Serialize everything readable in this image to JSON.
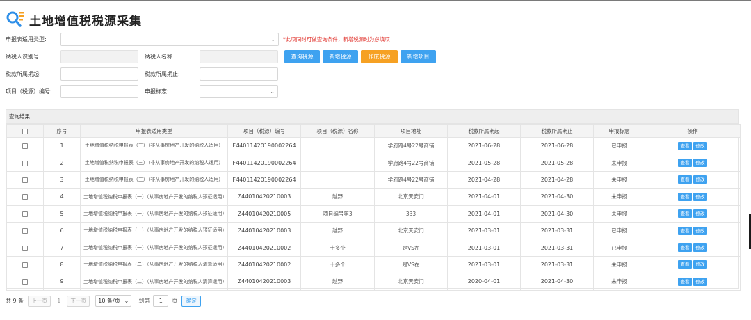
{
  "page": {
    "title": "土地增值税税源采集"
  },
  "form": {
    "report_type": {
      "label": "申报表适用类型:",
      "value": ""
    },
    "hint": "*此项同时可做查询条件，新增税源时为必填项",
    "taxpayer_id": {
      "label": "纳税人识别号:",
      "value": ""
    },
    "taxpayer_name": {
      "label": "纳税人名称:",
      "value": ""
    },
    "period_start": {
      "label": "税款所属期起:",
      "value": ""
    },
    "period_end": {
      "label": "税款所属期止:",
      "value": ""
    },
    "project_code": {
      "label": "项目（税源）编号:",
      "value": ""
    },
    "report_flag": {
      "label": "申报标志:",
      "value": ""
    }
  },
  "actions": {
    "query": "查询税源",
    "add_source": "新增税源",
    "void_source": "作废税源",
    "add_project": "新增项目"
  },
  "colors": {
    "primary": "#3ea2f0",
    "warning": "#f6a123",
    "hint": "#e0302a"
  },
  "results": {
    "heading": "查询结果",
    "columns": [
      "序号",
      "申报表适用类型",
      "项目（税源）编号",
      "项目（税源）名称",
      "项目地址",
      "税款所属期起",
      "税款所属期止",
      "申报标志",
      "操作"
    ],
    "view_label": "查看",
    "edit_label": "修改",
    "rows": [
      {
        "no": "1",
        "type": "土地增值税纳税申报表（三）（非从事房地产开发的纳税人适用）",
        "code": "F44011420190002264",
        "name": "",
        "address": "学府路4号22号商铺",
        "start": "2021-06-28",
        "end": "2021-06-28",
        "flag": "已申报"
      },
      {
        "no": "2",
        "type": "土地增值税纳税申报表（三）（非从事房地产开发的纳税人适用）",
        "code": "F44011420190002264",
        "name": "",
        "address": "学府路4号22号商铺",
        "start": "2021-05-28",
        "end": "2021-05-28",
        "flag": "未申报"
      },
      {
        "no": "3",
        "type": "土地增值税纳税申报表（三）（非从事房地产开发的纳税人适用）",
        "code": "F44011420190002264",
        "name": "",
        "address": "学府路4号22号商铺",
        "start": "2021-04-28",
        "end": "2021-04-28",
        "flag": "未申报"
      },
      {
        "no": "4",
        "type": "土地增值税纳税申报表（一）（从事房地产开发的纳税人预征适用）",
        "code": "Z44010420210003",
        "name": "越野",
        "address": "北京天安门",
        "start": "2021-04-01",
        "end": "2021-04-30",
        "flag": "未申报"
      },
      {
        "no": "5",
        "type": "土地增值税纳税申报表（一）（从事房地产开发的纳税人预征适用）",
        "code": "Z44010420210005",
        "name": "项目编号第3",
        "address": "333",
        "start": "2021-04-01",
        "end": "2021-04-30",
        "flag": "未申报"
      },
      {
        "no": "6",
        "type": "土地增值税纳税申报表（一）（从事房地产开发的纳税人预征适用）",
        "code": "Z44010420210003",
        "name": "越野",
        "address": "北京天安门",
        "start": "2021-03-01",
        "end": "2021-03-31",
        "flag": "已申报"
      },
      {
        "no": "7",
        "type": "土地增值税纳税申报表（一）（从事房地产开发的纳税人预征适用）",
        "code": "Z44010420210002",
        "name": "十多个",
        "address": "是VS在",
        "start": "2021-03-01",
        "end": "2021-03-31",
        "flag": "已申报"
      },
      {
        "no": "8",
        "type": "土地增值税纳税申报表（二）（从事房地产开发的纳税人清算适用）",
        "code": "Z44010420210002",
        "name": "十多个",
        "address": "是VS在",
        "start": "2021-03-01",
        "end": "2021-03-31",
        "flag": "未申报"
      },
      {
        "no": "9",
        "type": "土地增值税纳税申报表（二）（从事房地产开发的纳税人清算适用）",
        "code": "Z44010420210003",
        "name": "越野",
        "address": "北京天安门",
        "start": "2020-04-01",
        "end": "2021-04-30",
        "flag": "未申报"
      }
    ]
  },
  "pagination": {
    "total": "共 9 条",
    "prev": "上一页",
    "current": "1",
    "next": "下一页",
    "page_size": "10 条/页",
    "goto_prefix": "到第",
    "goto_value": "1",
    "goto_suffix": "页",
    "confirm": "确定"
  }
}
